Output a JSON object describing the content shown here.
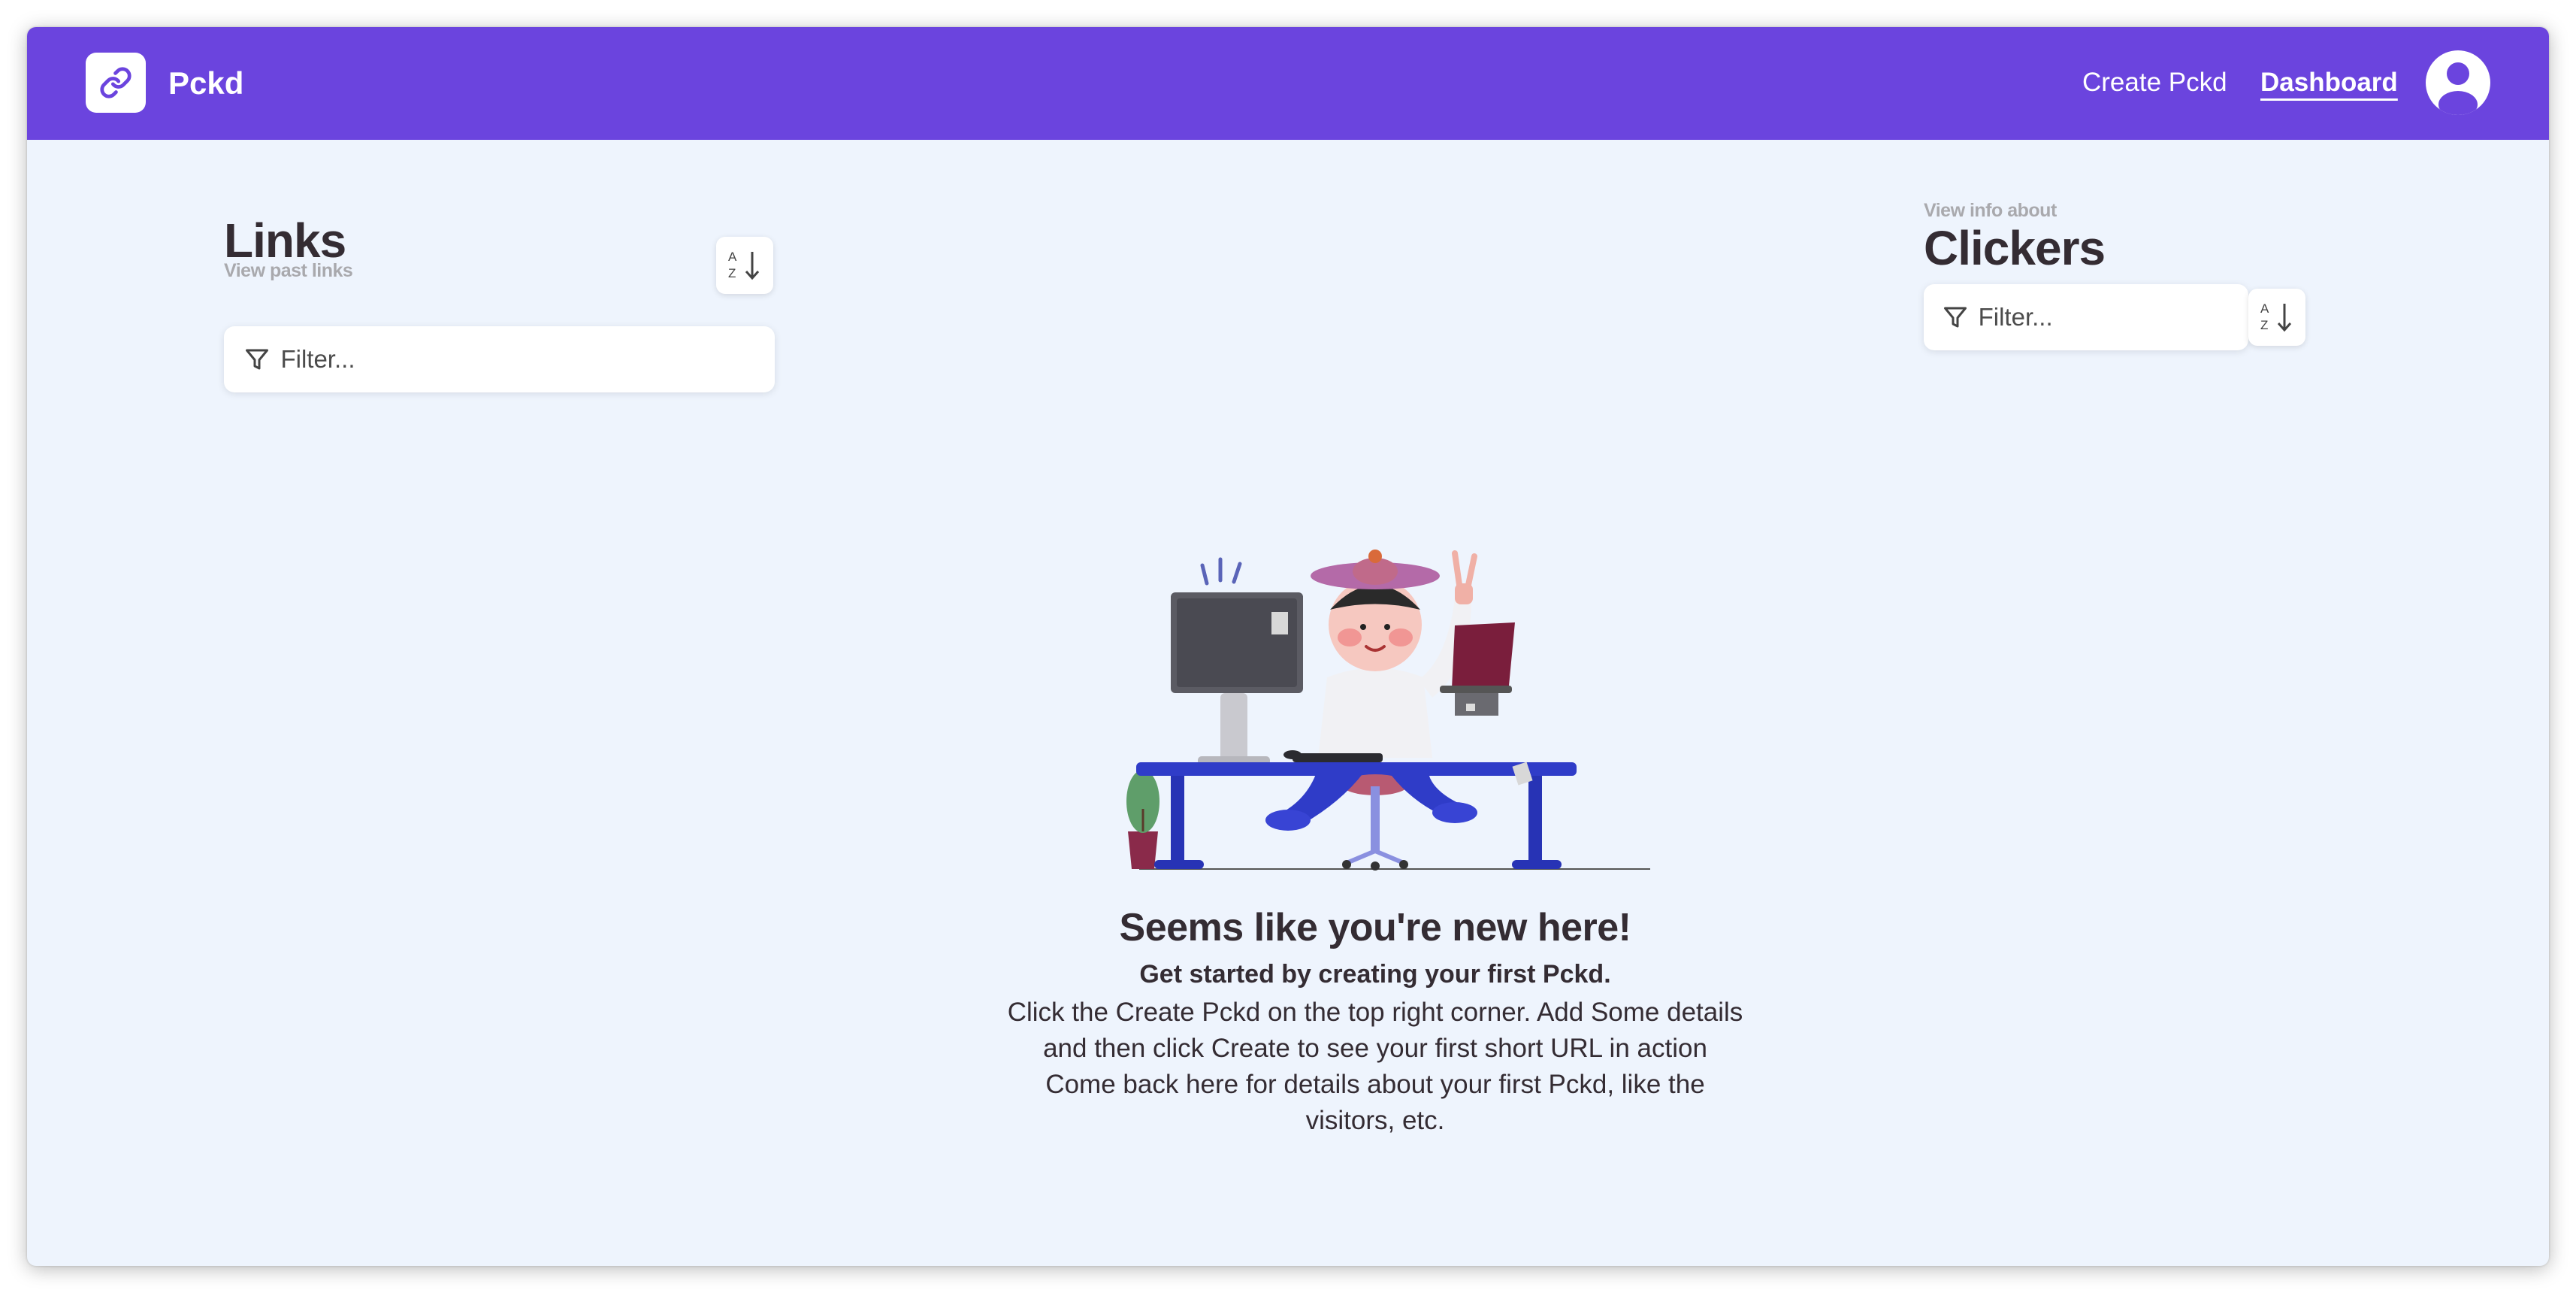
{
  "navbar": {
    "brand": "Pckd",
    "links": {
      "create": "Create Pckd",
      "dashboard": "Dashboard"
    },
    "icons": {
      "logo": "link-icon",
      "profile": "user-avatar-icon"
    },
    "colors": {
      "background": "#6b44de",
      "text": "#ffffff"
    }
  },
  "links_panel": {
    "title": "Links",
    "subtitle": "View past links",
    "filter_placeholder": "Filter...",
    "sort_icon": "sort-alpha-down-icon"
  },
  "clickers_panel": {
    "kicker": "View info about",
    "title": "Clickers",
    "filter_placeholder": "Filter...",
    "sort_icon": "sort-alpha-down-icon"
  },
  "empty_state": {
    "illustration": "person-at-desk-illustration",
    "title": "Seems like you're new here!",
    "subtitle": "Get started by creating your first Pckd.",
    "body_line1": "Click the Create Pckd on the top right corner. Add Some details and then click Create to see your first short URL in action",
    "body_line2": "Come back here for details about your first Pckd, like the visitors, etc."
  },
  "colors": {
    "page_background": "#eef4fd",
    "heading_text": "#342c33",
    "muted_text": "#a9a9ad",
    "accent": "#6b44de"
  }
}
